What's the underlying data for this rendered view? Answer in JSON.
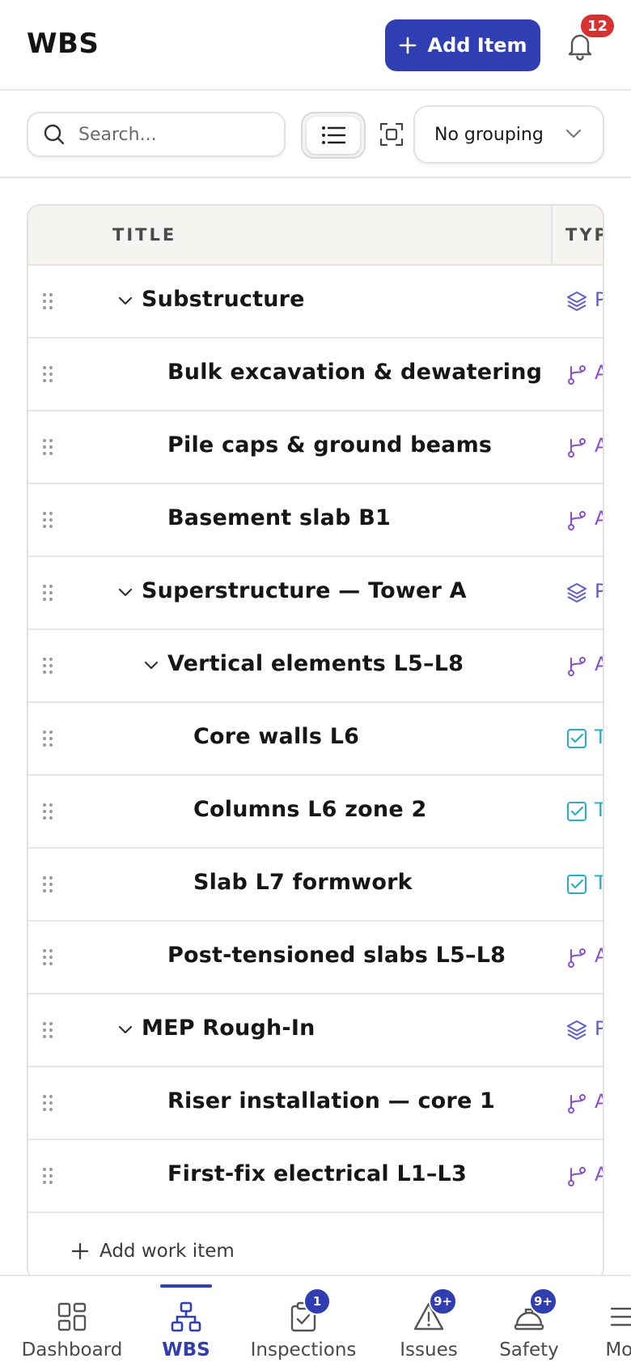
{
  "header": {
    "title": "WBS",
    "add_item_label": "Add Item",
    "notification_count": "12"
  },
  "toolbar": {
    "search_placeholder": "Search...",
    "grouping_value": "No grouping"
  },
  "table": {
    "columns": {
      "title": "TITLE",
      "type": "TYP"
    },
    "rows": [
      {
        "title": "Substructure",
        "level": 0,
        "expandable": true,
        "type": "phase",
        "type_letter": "P"
      },
      {
        "title": "Bulk excavation & dewatering",
        "level": 1,
        "expandable": false,
        "type": "activity",
        "type_letter": "A"
      },
      {
        "title": "Pile caps & ground beams",
        "level": 1,
        "expandable": false,
        "type": "activity",
        "type_letter": "A"
      },
      {
        "title": "Basement slab B1",
        "level": 1,
        "expandable": false,
        "type": "activity",
        "type_letter": "A"
      },
      {
        "title": "Superstructure — Tower A",
        "level": 0,
        "expandable": true,
        "type": "phase",
        "type_letter": "P"
      },
      {
        "title": "Vertical elements L5–L8",
        "level": 1,
        "expandable": true,
        "type": "activity",
        "type_letter": "A"
      },
      {
        "title": "Core walls L6",
        "level": 2,
        "expandable": false,
        "type": "task",
        "type_letter": "T"
      },
      {
        "title": "Columns L6 zone 2",
        "level": 2,
        "expandable": false,
        "type": "task",
        "type_letter": "T"
      },
      {
        "title": "Slab L7 formwork",
        "level": 2,
        "expandable": false,
        "type": "task",
        "type_letter": "T"
      },
      {
        "title": "Post-tensioned slabs L5–L8",
        "level": 1,
        "expandable": false,
        "type": "activity",
        "type_letter": "A"
      },
      {
        "title": "MEP Rough-In",
        "level": 0,
        "expandable": true,
        "type": "phase",
        "type_letter": "P"
      },
      {
        "title": "Riser installation — core 1",
        "level": 1,
        "expandable": false,
        "type": "activity",
        "type_letter": "A"
      },
      {
        "title": "First-fix electrical L1–L3",
        "level": 1,
        "expandable": false,
        "type": "activity",
        "type_letter": "A"
      }
    ],
    "add_work_item_label": "Add work item"
  },
  "type_colors": {
    "phase": "#5b5bd6",
    "activity": "#8a4fd8",
    "task": "#1fb1cf"
  },
  "bottom_nav": {
    "items": [
      {
        "label": "Dashboard",
        "icon": "dashboard-icon",
        "badge": ""
      },
      {
        "label": "WBS",
        "icon": "hierarchy-icon",
        "badge": ""
      },
      {
        "label": "Inspections",
        "icon": "clipboard-check-icon",
        "badge": "1"
      },
      {
        "label": "Issues",
        "icon": "warning-icon",
        "badge": "9+"
      },
      {
        "label": "Safety",
        "icon": "hard-hat-icon",
        "badge": "9+"
      },
      {
        "label": "Mor",
        "icon": "menu-icon",
        "badge": ""
      }
    ]
  },
  "colors": {
    "accent": "#2f3fb3",
    "notification_badge": "#d93030"
  }
}
